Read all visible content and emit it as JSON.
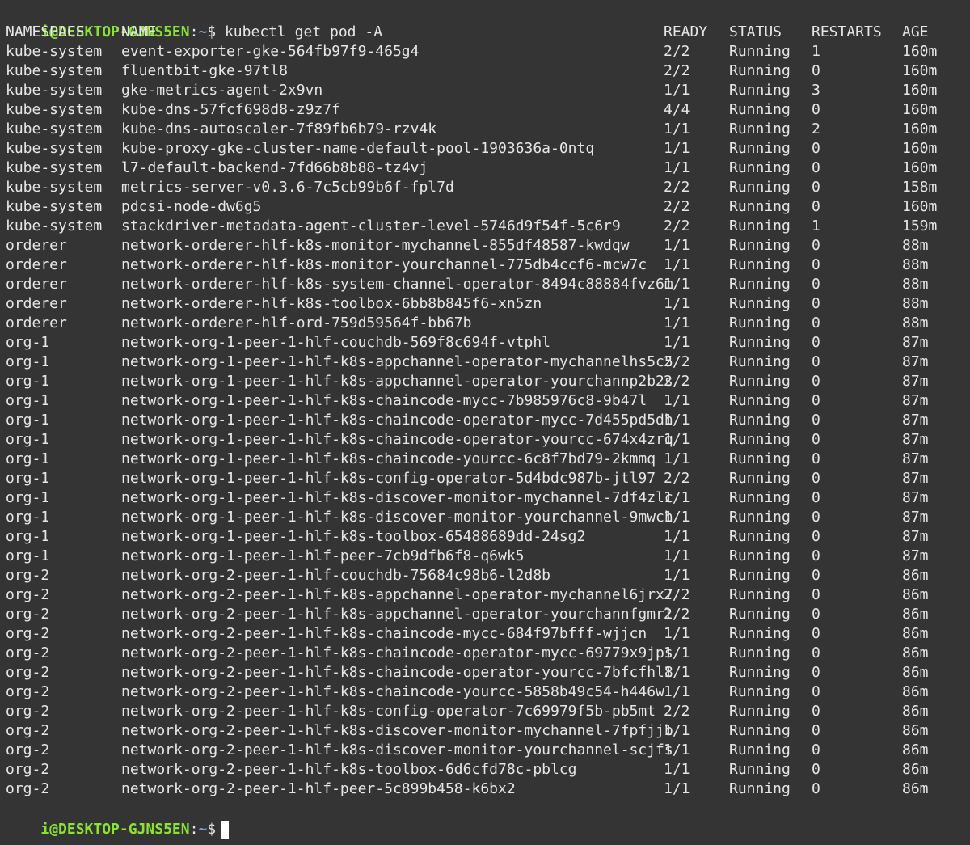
{
  "terminal": {
    "prompt_user": "i@DESKTOP-GJNS5EN",
    "prompt_sep": ":",
    "prompt_path": "~",
    "prompt_symbol": "$",
    "command": "kubectl get pod -A"
  },
  "columns": {
    "namespace": "NAMESPACE",
    "name": "NAME",
    "ready": "READY",
    "status": "STATUS",
    "restarts": "RESTARTS",
    "age": "AGE"
  },
  "rows": [
    {
      "ns": "kube-system",
      "name": "event-exporter-gke-564fb97f9-465g4",
      "ready": "2/2",
      "status": "Running",
      "restarts": "1",
      "age": "160m"
    },
    {
      "ns": "kube-system",
      "name": "fluentbit-gke-97tl8",
      "ready": "2/2",
      "status": "Running",
      "restarts": "0",
      "age": "160m"
    },
    {
      "ns": "kube-system",
      "name": "gke-metrics-agent-2x9vn",
      "ready": "1/1",
      "status": "Running",
      "restarts": "3",
      "age": "160m"
    },
    {
      "ns": "kube-system",
      "name": "kube-dns-57fcf698d8-z9z7f",
      "ready": "4/4",
      "status": "Running",
      "restarts": "0",
      "age": "160m"
    },
    {
      "ns": "kube-system",
      "name": "kube-dns-autoscaler-7f89fb6b79-rzv4k",
      "ready": "1/1",
      "status": "Running",
      "restarts": "2",
      "age": "160m"
    },
    {
      "ns": "kube-system",
      "name": "kube-proxy-gke-cluster-name-default-pool-1903636a-0ntq",
      "ready": "1/1",
      "status": "Running",
      "restarts": "0",
      "age": "160m"
    },
    {
      "ns": "kube-system",
      "name": "l7-default-backend-7fd66b8b88-tz4vj",
      "ready": "1/1",
      "status": "Running",
      "restarts": "0",
      "age": "160m"
    },
    {
      "ns": "kube-system",
      "name": "metrics-server-v0.3.6-7c5cb99b6f-fpl7d",
      "ready": "2/2",
      "status": "Running",
      "restarts": "0",
      "age": "158m"
    },
    {
      "ns": "kube-system",
      "name": "pdcsi-node-dw6g5",
      "ready": "2/2",
      "status": "Running",
      "restarts": "0",
      "age": "160m"
    },
    {
      "ns": "kube-system",
      "name": "stackdriver-metadata-agent-cluster-level-5746d9f54f-5c6r9",
      "ready": "2/2",
      "status": "Running",
      "restarts": "1",
      "age": "159m"
    },
    {
      "ns": "orderer",
      "name": "network-orderer-hlf-k8s-monitor-mychannel-855df48587-kwdqw",
      "ready": "1/1",
      "status": "Running",
      "restarts": "0",
      "age": "88m"
    },
    {
      "ns": "orderer",
      "name": "network-orderer-hlf-k8s-monitor-yourchannel-775db4ccf6-mcw7c",
      "ready": "1/1",
      "status": "Running",
      "restarts": "0",
      "age": "88m"
    },
    {
      "ns": "orderer",
      "name": "network-orderer-hlf-k8s-system-channel-operator-8494c88884fvz6m",
      "ready": "1/1",
      "status": "Running",
      "restarts": "0",
      "age": "88m"
    },
    {
      "ns": "orderer",
      "name": "network-orderer-hlf-k8s-toolbox-6bb8b845f6-xn5zn",
      "ready": "1/1",
      "status": "Running",
      "restarts": "0",
      "age": "88m"
    },
    {
      "ns": "orderer",
      "name": "network-orderer-hlf-ord-759d59564f-bb67b",
      "ready": "1/1",
      "status": "Running",
      "restarts": "0",
      "age": "88m"
    },
    {
      "ns": "org-1",
      "name": "network-org-1-peer-1-hlf-couchdb-569f8c694f-vtphl",
      "ready": "1/1",
      "status": "Running",
      "restarts": "0",
      "age": "87m"
    },
    {
      "ns": "org-1",
      "name": "network-org-1-peer-1-hlf-k8s-appchannel-operator-mychannelhs5c5",
      "ready": "2/2",
      "status": "Running",
      "restarts": "0",
      "age": "87m"
    },
    {
      "ns": "org-1",
      "name": "network-org-1-peer-1-hlf-k8s-appchannel-operator-yourchannp2b2s",
      "ready": "2/2",
      "status": "Running",
      "restarts": "0",
      "age": "87m"
    },
    {
      "ns": "org-1",
      "name": "network-org-1-peer-1-hlf-k8s-chaincode-mycc-7b985976c8-9b47l",
      "ready": "1/1",
      "status": "Running",
      "restarts": "0",
      "age": "87m"
    },
    {
      "ns": "org-1",
      "name": "network-org-1-peer-1-hlf-k8s-chaincode-operator-mycc-7d455pd5dh",
      "ready": "1/1",
      "status": "Running",
      "restarts": "0",
      "age": "87m"
    },
    {
      "ns": "org-1",
      "name": "network-org-1-peer-1-hlf-k8s-chaincode-operator-yourcc-674x4zrq",
      "ready": "1/1",
      "status": "Running",
      "restarts": "0",
      "age": "87m"
    },
    {
      "ns": "org-1",
      "name": "network-org-1-peer-1-hlf-k8s-chaincode-yourcc-6c8f7bd79-2kmmq",
      "ready": "1/1",
      "status": "Running",
      "restarts": "0",
      "age": "87m"
    },
    {
      "ns": "org-1",
      "name": "network-org-1-peer-1-hlf-k8s-config-operator-5d4bdc987b-jtl97",
      "ready": "2/2",
      "status": "Running",
      "restarts": "0",
      "age": "87m"
    },
    {
      "ns": "org-1",
      "name": "network-org-1-peer-1-hlf-k8s-discover-monitor-mychannel-7df4zlc",
      "ready": "1/1",
      "status": "Running",
      "restarts": "0",
      "age": "87m"
    },
    {
      "ns": "org-1",
      "name": "network-org-1-peer-1-hlf-k8s-discover-monitor-yourchannel-9mwch",
      "ready": "1/1",
      "status": "Running",
      "restarts": "0",
      "age": "87m"
    },
    {
      "ns": "org-1",
      "name": "network-org-1-peer-1-hlf-k8s-toolbox-65488689dd-24sg2",
      "ready": "1/1",
      "status": "Running",
      "restarts": "0",
      "age": "87m"
    },
    {
      "ns": "org-1",
      "name": "network-org-1-peer-1-hlf-peer-7cb9dfb6f8-q6wk5",
      "ready": "1/1",
      "status": "Running",
      "restarts": "0",
      "age": "87m"
    },
    {
      "ns": "org-2",
      "name": "network-org-2-peer-1-hlf-couchdb-75684c98b6-l2d8b",
      "ready": "1/1",
      "status": "Running",
      "restarts": "0",
      "age": "86m"
    },
    {
      "ns": "org-2",
      "name": "network-org-2-peer-1-hlf-k8s-appchannel-operator-mychannel6jrx7",
      "ready": "2/2",
      "status": "Running",
      "restarts": "0",
      "age": "86m"
    },
    {
      "ns": "org-2",
      "name": "network-org-2-peer-1-hlf-k8s-appchannel-operator-yourchannfgmrl",
      "ready": "2/2",
      "status": "Running",
      "restarts": "0",
      "age": "86m"
    },
    {
      "ns": "org-2",
      "name": "network-org-2-peer-1-hlf-k8s-chaincode-mycc-684f97bfff-wjjcn",
      "ready": "1/1",
      "status": "Running",
      "restarts": "0",
      "age": "86m"
    },
    {
      "ns": "org-2",
      "name": "network-org-2-peer-1-hlf-k8s-chaincode-operator-mycc-69779x9jps",
      "ready": "1/1",
      "status": "Running",
      "restarts": "0",
      "age": "86m"
    },
    {
      "ns": "org-2",
      "name": "network-org-2-peer-1-hlf-k8s-chaincode-operator-yourcc-7bfcfhl8",
      "ready": "1/1",
      "status": "Running",
      "restarts": "0",
      "age": "86m"
    },
    {
      "ns": "org-2",
      "name": "network-org-2-peer-1-hlf-k8s-chaincode-yourcc-5858b49c54-h446w",
      "ready": "1/1",
      "status": "Running",
      "restarts": "0",
      "age": "86m"
    },
    {
      "ns": "org-2",
      "name": "network-org-2-peer-1-hlf-k8s-config-operator-7c69979f5b-pb5mt",
      "ready": "2/2",
      "status": "Running",
      "restarts": "0",
      "age": "86m"
    },
    {
      "ns": "org-2",
      "name": "network-org-2-peer-1-hlf-k8s-discover-monitor-mychannel-7fpfjjb",
      "ready": "1/1",
      "status": "Running",
      "restarts": "0",
      "age": "86m"
    },
    {
      "ns": "org-2",
      "name": "network-org-2-peer-1-hlf-k8s-discover-monitor-yourchannel-scjfs",
      "ready": "1/1",
      "status": "Running",
      "restarts": "0",
      "age": "86m"
    },
    {
      "ns": "org-2",
      "name": "network-org-2-peer-1-hlf-k8s-toolbox-6d6cfd78c-pblcg",
      "ready": "1/1",
      "status": "Running",
      "restarts": "0",
      "age": "86m"
    },
    {
      "ns": "org-2",
      "name": "network-org-2-peer-1-hlf-peer-5c899b458-k6bx2",
      "ready": "1/1",
      "status": "Running",
      "restarts": "0",
      "age": "86m"
    }
  ],
  "colors": {
    "background": "#343434",
    "text": "#e6e6e6",
    "prompt_user": "#8ae234",
    "prompt_path": "#729fcf",
    "cursor": "#ffffff"
  }
}
